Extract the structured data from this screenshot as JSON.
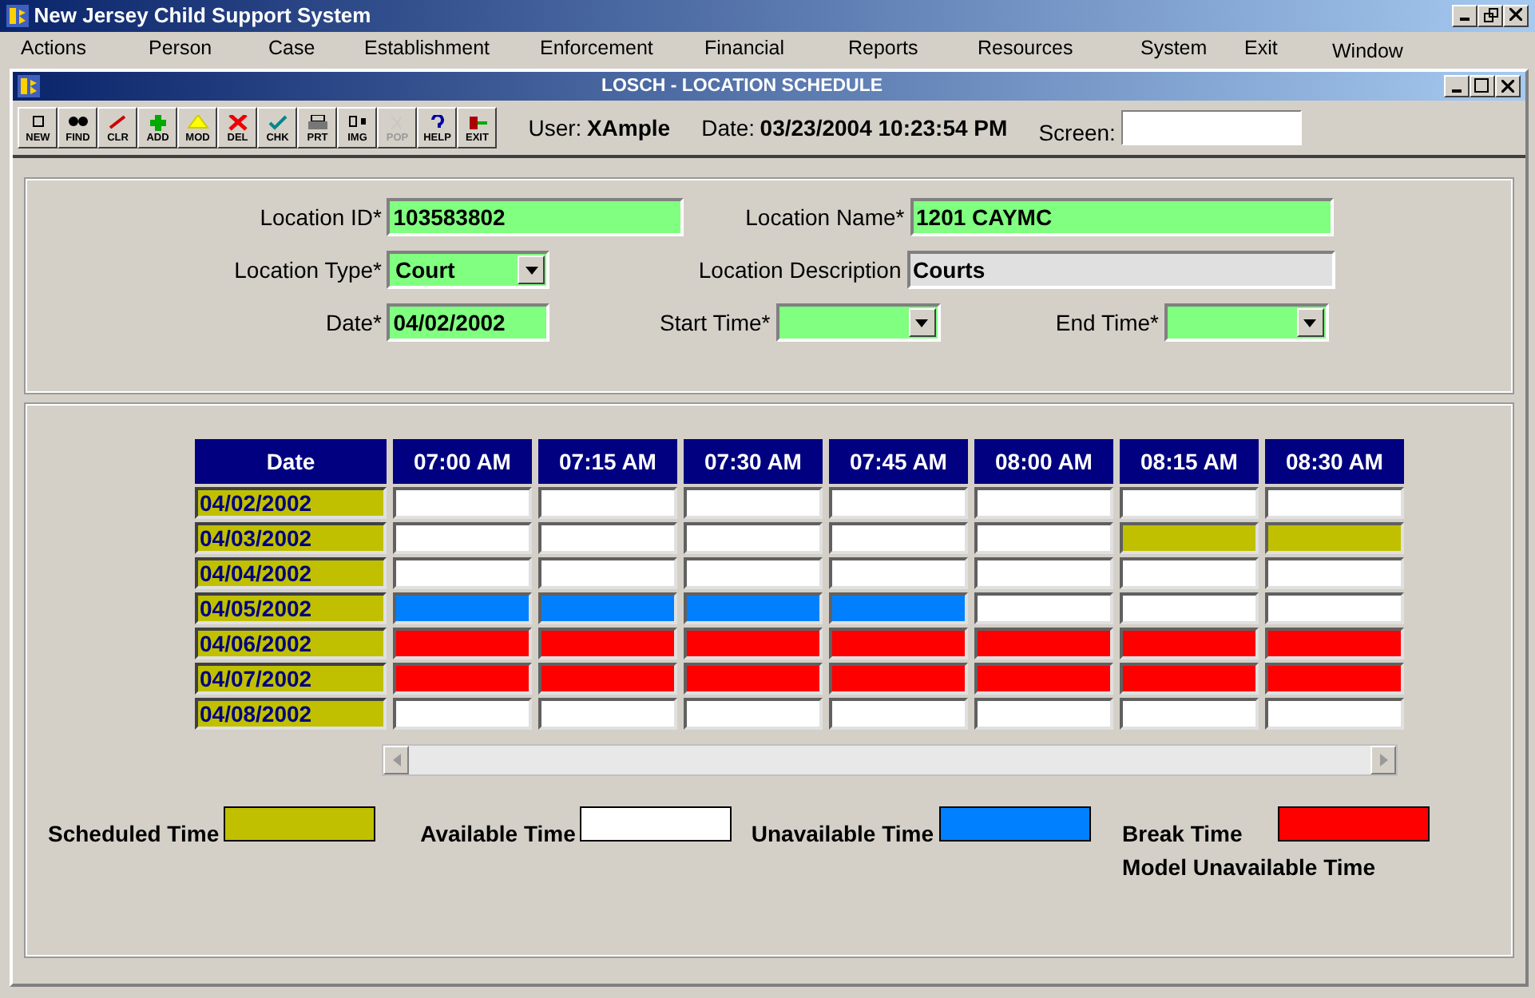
{
  "app_window": {
    "title": "New Jersey Child Support System"
  },
  "menu": [
    "Actions",
    "Person",
    "Case",
    "Establishment",
    "Enforcement",
    "Financial",
    "Reports",
    "Resources",
    "System",
    "Exit",
    "Window"
  ],
  "child_window": {
    "title": "LOSCH - LOCATION SCHEDULE"
  },
  "toolbar": [
    {
      "label": "NEW",
      "disabled": false
    },
    {
      "label": "FIND",
      "disabled": false
    },
    {
      "label": "CLR",
      "disabled": false
    },
    {
      "label": "ADD",
      "disabled": false
    },
    {
      "label": "MOD",
      "disabled": false
    },
    {
      "label": "DEL",
      "disabled": false
    },
    {
      "label": "CHK",
      "disabled": false
    },
    {
      "label": "PRT",
      "disabled": false
    },
    {
      "label": "IMG",
      "disabled": false
    },
    {
      "label": "POP",
      "disabled": true
    },
    {
      "label": "HELP",
      "disabled": false
    },
    {
      "label": "EXIT",
      "disabled": false
    }
  ],
  "user": {
    "label": "User:",
    "value": "XAmple"
  },
  "date": {
    "label": "Date:",
    "value": "03/23/2004 10:23:54 PM"
  },
  "screen": {
    "label": "Screen:"
  },
  "form": {
    "location_id": {
      "label": "Location ID*",
      "value": "103583802"
    },
    "location_name": {
      "label": "Location Name*",
      "value": "1201 CAYMC"
    },
    "location_type": {
      "label": "Location Type*",
      "value": "Court"
    },
    "location_description": {
      "label": "Location Description",
      "value": "Courts"
    },
    "date": {
      "label": "Date*",
      "value": "04/02/2002"
    },
    "start_time": {
      "label": "Start Time*"
    },
    "end_time": {
      "label": "End Time*"
    }
  },
  "schedule": {
    "columns": [
      "Date",
      "07:00 AM",
      "07:15 AM",
      "07:30 AM",
      "07:45 AM",
      "08:00 AM",
      "08:15 AM",
      "08:30 AM"
    ],
    "rows": [
      {
        "date": "04/02/2002",
        "slots": [
          {
            "kind": "available"
          },
          {
            "kind": "available"
          },
          {
            "kind": "available"
          },
          {
            "kind": "available"
          },
          {
            "kind": "available"
          },
          {
            "kind": "available"
          },
          {
            "kind": "available"
          }
        ]
      },
      {
        "date": "04/03/2002",
        "slots": [
          {
            "kind": "available"
          },
          {
            "kind": "available"
          },
          {
            "kind": "available"
          },
          {
            "kind": "available"
          },
          {
            "kind": "available"
          },
          {
            "kind": "scheduled"
          },
          {
            "kind": "scheduled"
          }
        ]
      },
      {
        "date": "04/04/2002",
        "slots": [
          {
            "kind": "available"
          },
          {
            "kind": "available"
          },
          {
            "kind": "available"
          },
          {
            "kind": "available"
          },
          {
            "kind": "available"
          },
          {
            "kind": "available"
          },
          {
            "kind": "available"
          }
        ]
      },
      {
        "date": "04/05/2002",
        "slots": [
          {
            "kind": "unavailable"
          },
          {
            "kind": "unavailable"
          },
          {
            "kind": "unavailable"
          },
          {
            "kind": "unavailable"
          },
          {
            "kind": "available"
          },
          {
            "kind": "available"
          },
          {
            "kind": "available"
          }
        ]
      },
      {
        "date": "04/06/2002",
        "slots": [
          {
            "kind": "break"
          },
          {
            "kind": "break"
          },
          {
            "kind": "break"
          },
          {
            "kind": "break"
          },
          {
            "kind": "break"
          },
          {
            "kind": "break"
          },
          {
            "kind": "break"
          }
        ]
      },
      {
        "date": "04/07/2002",
        "slots": [
          {
            "kind": "break"
          },
          {
            "kind": "break"
          },
          {
            "kind": "break"
          },
          {
            "kind": "break"
          },
          {
            "kind": "break"
          },
          {
            "kind": "break"
          },
          {
            "kind": "break"
          }
        ]
      },
      {
        "date": "04/08/2002",
        "slots": [
          {
            "kind": "available"
          },
          {
            "kind": "available"
          },
          {
            "kind": "available"
          },
          {
            "kind": "available"
          },
          {
            "kind": "available"
          },
          {
            "kind": "available"
          },
          {
            "kind": "available"
          }
        ]
      }
    ]
  },
  "legend": [
    {
      "kind": "scheduled",
      "label": "Scheduled Time",
      "color": "#c0c000"
    },
    {
      "kind": "available",
      "label": "Available Time",
      "color": "#ffffff"
    },
    {
      "kind": "unavailable",
      "label": "Unavailable Time",
      "color": "#0080ff"
    },
    {
      "kind": "break",
      "label": "Break Time",
      "note": "Model Unavailable Time",
      "color": "#ff0000"
    }
  ]
}
